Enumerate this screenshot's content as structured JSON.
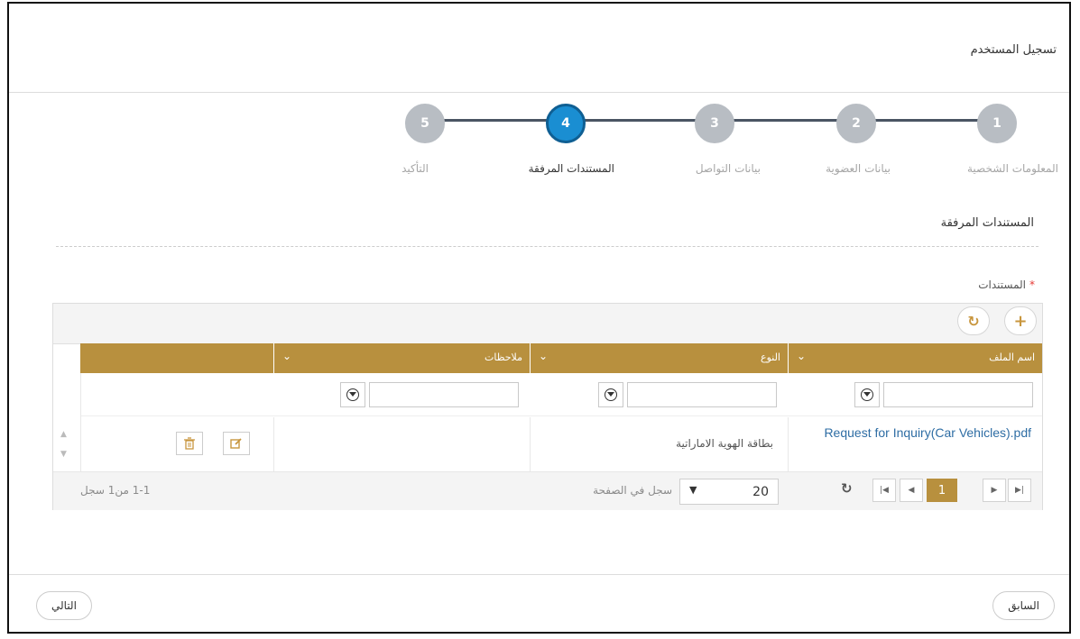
{
  "header": {
    "title": "تسجيل المستخدم"
  },
  "stepper": {
    "steps": [
      {
        "number": "1",
        "label": "المعلومات الشخصية",
        "state": "inactive"
      },
      {
        "number": "2",
        "label": "بيانات العضوية",
        "state": "inactive"
      },
      {
        "number": "3",
        "label": "بيانات التواصل",
        "state": "inactive"
      },
      {
        "number": "4",
        "label": "المستندات المرفقة",
        "state": "active"
      },
      {
        "number": "5",
        "label": "التأكيد",
        "state": "inactive"
      }
    ]
  },
  "section": {
    "title": "المستندات المرفقة"
  },
  "documents_field": {
    "label": "المستندات",
    "required_mark": "*"
  },
  "grid": {
    "toolbar": {
      "add_icon": "+",
      "refresh_icon": "↻"
    },
    "columns": [
      {
        "label": "اسم الملف",
        "chevron": "⌄"
      },
      {
        "label": "النوع",
        "chevron": "⌄"
      },
      {
        "label": "ملاحظات",
        "chevron": "⌄"
      }
    ],
    "rows": [
      {
        "file_name": "Request for Inquiry(Car Vehicles).pdf",
        "type": "بطاقة الهوية الاماراتية",
        "notes": ""
      }
    ],
    "pager": {
      "current_page": "1",
      "page_size": "20",
      "page_size_label": "سجل في الصفحة",
      "summary": "1-1 من1 سجل"
    }
  },
  "footer": {
    "prev_label": "السابق",
    "next_label": "التالي"
  },
  "colors": {
    "accent": "#b8903e",
    "active_step": "#1a8ed2",
    "inactive_step": "#b8bdc3",
    "link": "#2e6da4"
  }
}
